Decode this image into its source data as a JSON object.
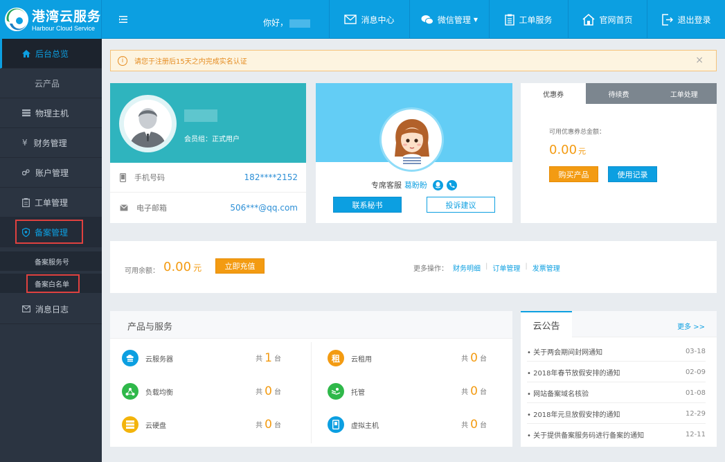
{
  "header": {
    "logo_cn": "港湾云服务",
    "logo_en": "Harbour Cloud Service",
    "greeting": "你好，",
    "nav": [
      {
        "label": "消息中心",
        "icon": "mail-icon"
      },
      {
        "label": "微信管理",
        "icon": "wechat-icon"
      },
      {
        "label": "工单服务",
        "icon": "ticket-icon"
      },
      {
        "label": "官网首页",
        "icon": "home-icon"
      },
      {
        "label": "退出登录",
        "icon": "logout-icon"
      }
    ]
  },
  "sidebar": {
    "items": [
      {
        "label": "后台总览",
        "icon": "home-icon"
      },
      {
        "label": "云产品"
      },
      {
        "label": "物理主机",
        "icon": "server-icon"
      },
      {
        "label": "财务管理",
        "icon": "yen-icon"
      },
      {
        "label": "账户管理",
        "icon": "key-icon"
      },
      {
        "label": "工单管理",
        "icon": "clipboard-icon"
      },
      {
        "label": "备案管理",
        "icon": "shield-icon"
      },
      {
        "label": "消息日志",
        "icon": "mail-icon"
      }
    ],
    "subitems": [
      "备案服务号",
      "备案白名单"
    ]
  },
  "notice": {
    "text": "请您于注册后15天之内完成实名认证",
    "close": "×",
    "icon_glyph": "i"
  },
  "profile": {
    "member_group": "会员组：正式用户",
    "phone_label": "手机号码",
    "phone_value": "182****2152",
    "email_label": "电子邮箱",
    "email_value": "506***@qq.com"
  },
  "service": {
    "label": "专席客服",
    "name": "葛盼盼",
    "contact_button": "联系秘书",
    "complaint_button": "投诉建议"
  },
  "coupon": {
    "tabs": [
      "优惠券",
      "待续费",
      "工单处理"
    ],
    "total_label": "可用优惠券总金额：",
    "amount": "0.00",
    "unit": "元",
    "buy_button": "购买产品",
    "history_button": "使用记录"
  },
  "balance": {
    "label": "可用余额：",
    "amount": "0.00",
    "unit": "元",
    "recharge_button": "立即充值",
    "more_label": "更多操作：",
    "links": [
      "财务明细",
      "订单管理",
      "发票管理"
    ],
    "separator": "|"
  },
  "products": {
    "title": "产品与服务",
    "prefix": "共",
    "suffix": "台",
    "items": [
      {
        "name": "云服务器",
        "count": "1",
        "icon": "cloud-server-icon",
        "color": "#0c9fe1"
      },
      {
        "name": "云租用",
        "count": "0",
        "icon": "rent-icon",
        "color": "#f39b12"
      },
      {
        "name": "负载均衡",
        "count": "0",
        "icon": "load-balance-icon",
        "color": "#2fb84a"
      },
      {
        "name": "托管",
        "count": "0",
        "icon": "hosting-icon",
        "color": "#2fb84a"
      },
      {
        "name": "云硬盘",
        "count": "0",
        "icon": "disk-icon",
        "color": "#f3b40c"
      },
      {
        "name": "虚拟主机",
        "count": "0",
        "icon": "vhost-icon",
        "color": "#0c9fe1"
      }
    ]
  },
  "announcements": {
    "title": "云公告",
    "more": "更多 >>",
    "items": [
      {
        "title": "• 关于两会期间封网通知",
        "date": "03-18"
      },
      {
        "title": "• 2018年春节放假安排的通知",
        "date": "02-09"
      },
      {
        "title": "• 网站备案域名核验",
        "date": "01-08"
      },
      {
        "title": "• 2018年元旦放假安排的通知",
        "date": "12-29"
      },
      {
        "title": "• 关于提供备案服务码进行备案的通知",
        "date": "12-11"
      }
    ]
  },
  "colors": {
    "primary": "#0c9fe1",
    "accent": "#f39b12",
    "sidebar": "#2b3441",
    "teal": "#2fb4be"
  }
}
